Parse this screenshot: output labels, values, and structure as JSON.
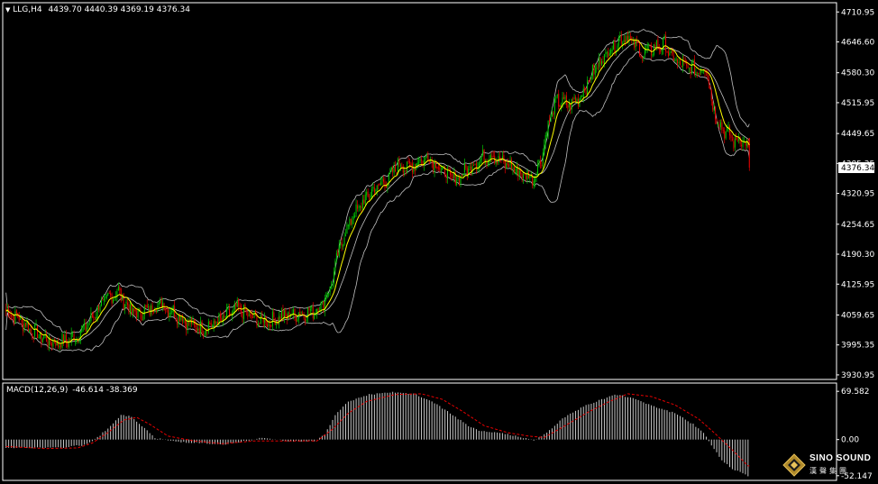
{
  "main_header": {
    "symbol": "LLG,H4",
    "ohlc": "4439.70 4440.39 4369.19 4376.34"
  },
  "macd_header": {
    "label": "MACD(12,26,9)",
    "values": "-46.614 -38.369"
  },
  "logo": {
    "brand": "SINO SOUND",
    "cn": "漢聲集團"
  },
  "colors": {
    "background": "#000000",
    "bull_candle": "#00c800",
    "bear_candle": "#e60000",
    "bollinger": "#c0c0c0",
    "ma_line": "#ffff00",
    "signal_line": "#e60000",
    "histogram": "#c8c8c8",
    "axis_text": "#ffffff",
    "price_marker_bg": "#ffffff"
  },
  "chart_data": [
    {
      "type": "candlestick",
      "series": [
        {
          "name": "price"
        },
        {
          "name": "bollinger"
        },
        {
          "name": "ma"
        }
      ],
      "y_ticks": [
        "4710.95",
        "4646.60",
        "4580.30",
        "4515.95",
        "4449.65",
        "4385.35",
        "4320.95",
        "4254.65",
        "4190.30",
        "4125.95",
        "4059.65",
        "3995.35",
        "3930.95"
      ],
      "y_tick_values": [
        4710.95,
        4646.6,
        4580.3,
        4515.95,
        4449.65,
        4385.35,
        4320.95,
        4254.65,
        4190.3,
        4125.95,
        4059.65,
        3995.35,
        3930.95
      ],
      "ylim": [
        3925,
        4725
      ],
      "current_price": "4376.34",
      "current_price_value": 4376.34,
      "path_anchors": [
        [
          0,
          4068
        ],
        [
          8,
          4055
        ],
        [
          18,
          4030
        ],
        [
          28,
          4010
        ],
        [
          36,
          4000
        ],
        [
          48,
          4005
        ],
        [
          56,
          4020
        ],
        [
          64,
          4045
        ],
        [
          72,
          4080
        ],
        [
          80,
          4100
        ],
        [
          86,
          4110
        ],
        [
          92,
          4080
        ],
        [
          100,
          4060
        ],
        [
          108,
          4070
        ],
        [
          118,
          4085
        ],
        [
          126,
          4070
        ],
        [
          136,
          4050
        ],
        [
          148,
          4030
        ],
        [
          158,
          4040
        ],
        [
          168,
          4055
        ],
        [
          178,
          4075
        ],
        [
          184,
          4060
        ],
        [
          192,
          4050
        ],
        [
          202,
          4045
        ],
        [
          208,
          4055
        ],
        [
          216,
          4060
        ],
        [
          224,
          4062
        ],
        [
          232,
          4065
        ],
        [
          240,
          4075
        ],
        [
          248,
          4115
        ],
        [
          256,
          4210
        ],
        [
          264,
          4265
        ],
        [
          270,
          4290
        ],
        [
          278,
          4320
        ],
        [
          286,
          4340
        ],
        [
          294,
          4355
        ],
        [
          300,
          4385
        ],
        [
          308,
          4375
        ],
        [
          316,
          4390
        ],
        [
          324,
          4400
        ],
        [
          330,
          4380
        ],
        [
          338,
          4360
        ],
        [
          344,
          4350
        ],
        [
          352,
          4370
        ],
        [
          358,
          4385
        ],
        [
          364,
          4395
        ],
        [
          372,
          4405
        ],
        [
          378,
          4390
        ],
        [
          386,
          4380
        ],
        [
          392,
          4365
        ],
        [
          398,
          4360
        ],
        [
          404,
          4355
        ],
        [
          410,
          4400
        ],
        [
          416,
          4480
        ],
        [
          422,
          4520
        ],
        [
          430,
          4510
        ],
        [
          436,
          4520
        ],
        [
          442,
          4540
        ],
        [
          448,
          4575
        ],
        [
          456,
          4610
        ],
        [
          462,
          4630
        ],
        [
          468,
          4645
        ],
        [
          474,
          4660
        ],
        [
          482,
          4640
        ],
        [
          488,
          4620
        ],
        [
          496,
          4635
        ],
        [
          504,
          4640
        ],
        [
          510,
          4610
        ],
        [
          518,
          4595
        ],
        [
          524,
          4590
        ],
        [
          532,
          4585
        ],
        [
          536,
          4600
        ],
        [
          540,
          4520
        ],
        [
          546,
          4470
        ],
        [
          552,
          4450
        ],
        [
          558,
          4430
        ],
        [
          562,
          4440
        ],
        [
          566,
          4430
        ],
        [
          568,
          4410
        ]
      ]
    },
    {
      "type": "bar",
      "title": "MACD(12,26,9)",
      "y_ticks": [
        "69.582",
        "0.00",
        "-52.147"
      ],
      "y_tick_values": [
        69.582,
        0.0,
        -52.147
      ],
      "ylim": [
        -55,
        75
      ],
      "macd_anchors": [
        [
          0,
          -12
        ],
        [
          20,
          -12
        ],
        [
          40,
          -12
        ],
        [
          60,
          -8
        ],
        [
          70,
          3
        ],
        [
          80,
          20
        ],
        [
          88,
          35
        ],
        [
          96,
          33
        ],
        [
          104,
          20
        ],
        [
          114,
          2
        ],
        [
          130,
          -3
        ],
        [
          150,
          -5
        ],
        [
          166,
          -8
        ],
        [
          180,
          -3
        ],
        [
          196,
          2
        ],
        [
          216,
          -2
        ],
        [
          236,
          -2
        ],
        [
          244,
          8
        ],
        [
          252,
          35
        ],
        [
          262,
          55
        ],
        [
          278,
          65
        ],
        [
          296,
          68
        ],
        [
          312,
          66
        ],
        [
          326,
          55
        ],
        [
          340,
          38
        ],
        [
          352,
          22
        ],
        [
          362,
          12
        ],
        [
          376,
          10
        ],
        [
          392,
          5
        ],
        [
          404,
          -2
        ],
        [
          414,
          10
        ],
        [
          426,
          30
        ],
        [
          442,
          48
        ],
        [
          456,
          58
        ],
        [
          466,
          65
        ],
        [
          480,
          60
        ],
        [
          496,
          48
        ],
        [
          512,
          38
        ],
        [
          526,
          22
        ],
        [
          534,
          10
        ],
        [
          540,
          -8
        ],
        [
          548,
          -30
        ],
        [
          556,
          -42
        ],
        [
          566,
          -50
        ],
        [
          568,
          -52
        ]
      ],
      "signal_anchors": [
        [
          0,
          -10
        ],
        [
          30,
          -13
        ],
        [
          55,
          -12
        ],
        [
          66,
          -5
        ],
        [
          78,
          10
        ],
        [
          90,
          28
        ],
        [
          100,
          32
        ],
        [
          110,
          22
        ],
        [
          124,
          5
        ],
        [
          144,
          -2
        ],
        [
          166,
          -6
        ],
        [
          190,
          -2
        ],
        [
          215,
          -2
        ],
        [
          238,
          -2
        ],
        [
          250,
          15
        ],
        [
          262,
          38
        ],
        [
          276,
          55
        ],
        [
          298,
          65
        ],
        [
          318,
          66
        ],
        [
          334,
          58
        ],
        [
          350,
          40
        ],
        [
          366,
          20
        ],
        [
          384,
          10
        ],
        [
          400,
          5
        ],
        [
          412,
          3
        ],
        [
          428,
          20
        ],
        [
          446,
          40
        ],
        [
          462,
          55
        ],
        [
          476,
          66
        ],
        [
          494,
          62
        ],
        [
          512,
          50
        ],
        [
          530,
          30
        ],
        [
          542,
          10
        ],
        [
          556,
          -15
        ],
        [
          568,
          -38
        ]
      ]
    }
  ]
}
